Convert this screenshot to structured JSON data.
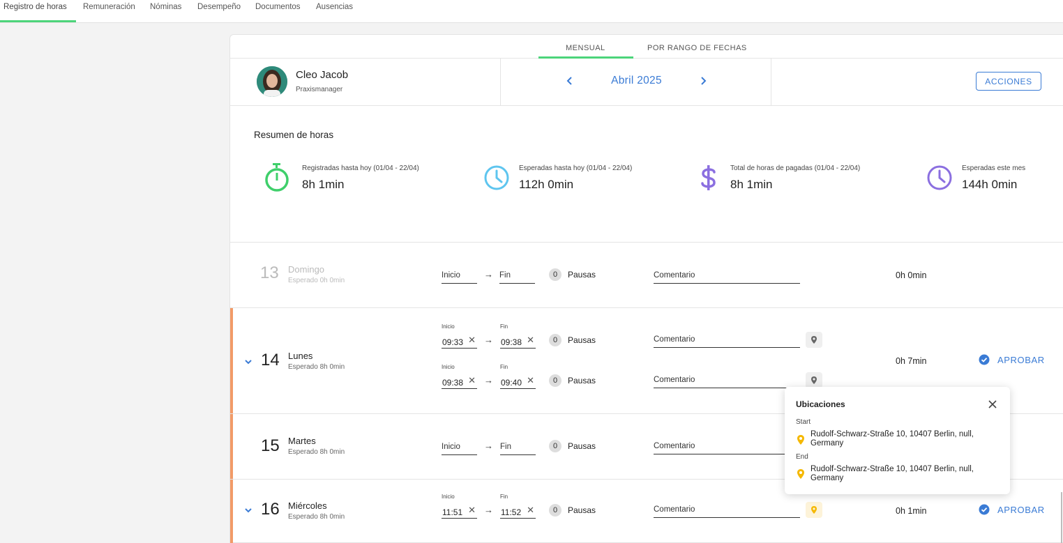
{
  "topnav": {
    "tabs": [
      {
        "label": "Registro de horas",
        "active": true
      },
      {
        "label": "Remuneración"
      },
      {
        "label": "Nóminas"
      },
      {
        "label": "Desempeño"
      },
      {
        "label": "Documentos"
      },
      {
        "label": "Ausencias"
      }
    ]
  },
  "subtabs": {
    "monthly": "MENSUAL",
    "range": "POR RANGO DE FECHAS"
  },
  "employee": {
    "name": "Cleo Jacob",
    "role": "Praxismanager"
  },
  "period": {
    "month": "Abril 2025"
  },
  "actions_label": "ACCIONES",
  "summary": {
    "title": "Resumen de horas",
    "stats": [
      {
        "label": "Registradas hasta hoy (01/04 - 22/04)",
        "value": "8h 1min",
        "icon": "stopwatch-icon",
        "color": "#3fcf6b"
      },
      {
        "label": "Esperadas hasta hoy (01/04 - 22/04)",
        "value": "112h 0min",
        "icon": "clock-icon",
        "color": "#5ec5ef"
      },
      {
        "label": "Total de horas de pagadas (01/04 - 22/04)",
        "value": "8h 1min",
        "icon": "dollar-icon",
        "color": "#8b6fe0"
      },
      {
        "label": "Esperadas este mes",
        "value": "144h 0min",
        "icon": "clock-icon",
        "color": "#8b6fe0"
      }
    ]
  },
  "labels": {
    "inicio": "Inicio",
    "fin": "Fin",
    "pausas": "Pausas",
    "comentario": "Comentario",
    "aprobar": "APROBAR",
    "arrow": "→",
    "clear": "✕"
  },
  "days": [
    {
      "num": "13",
      "name": "Domingo",
      "expected": "Esperado 0h 0min",
      "total": "0h 0min",
      "entries": [
        {
          "start": "",
          "end": "",
          "breaks": "0"
        }
      ]
    },
    {
      "num": "14",
      "name": "Lunes",
      "expected": "Esperado 8h 0min",
      "total": "0h 7min",
      "entries": [
        {
          "start": "09:33",
          "end": "09:38",
          "breaks": "0"
        },
        {
          "start": "09:38",
          "end": "09:40",
          "breaks": "0"
        }
      ]
    },
    {
      "num": "15",
      "name": "Martes",
      "expected": "Esperado 8h 0min",
      "total": "",
      "entries": [
        {
          "start": "",
          "end": "",
          "breaks": "0"
        }
      ]
    },
    {
      "num": "16",
      "name": "Miércoles",
      "expected": "Esperado 8h 0min",
      "total": "0h 1min",
      "entries": [
        {
          "start": "11:51",
          "end": "11:52",
          "breaks": "0"
        }
      ]
    }
  ],
  "popup": {
    "title": "Ubicaciones",
    "start_label": "Start",
    "start_address": "Rudolf-Schwarz-Straße 10, 10407 Berlin, null, Germany",
    "end_label": "End",
    "end_address": "Rudolf-Schwarz-Straße 10, 10407 Berlin, null, Germany"
  },
  "colors": {
    "accent_blue": "#3a7bd5",
    "accent_green": "#4cd47a",
    "row_accent": "#f29b68",
    "pin_yellow": "#f5b800"
  }
}
